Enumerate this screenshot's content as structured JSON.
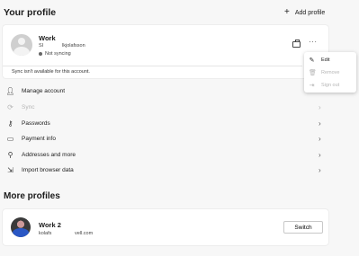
{
  "header": {
    "title": "Your profile",
    "add_profile_label": "Add profile"
  },
  "current_profile": {
    "name": "Work",
    "initials": "SI",
    "email": "lkjolafsson",
    "status": "Not syncing",
    "sync_note": "Sync isn't available for this account."
  },
  "profile_menu": {
    "items": [
      "Edit",
      "Remove",
      "Sign out"
    ]
  },
  "settings": {
    "items": [
      {
        "label": "Manage account"
      },
      {
        "label": "Sync"
      },
      {
        "label": "Passwords"
      },
      {
        "label": "Payment info"
      },
      {
        "label": "Addresses and more"
      },
      {
        "label": "Import browser data"
      }
    ]
  },
  "more_profiles": {
    "title": "More profiles",
    "profiles": [
      {
        "name": "Work 2",
        "user": "kolafs",
        "domain": "vell.com",
        "button_label": "Switch"
      }
    ]
  }
}
